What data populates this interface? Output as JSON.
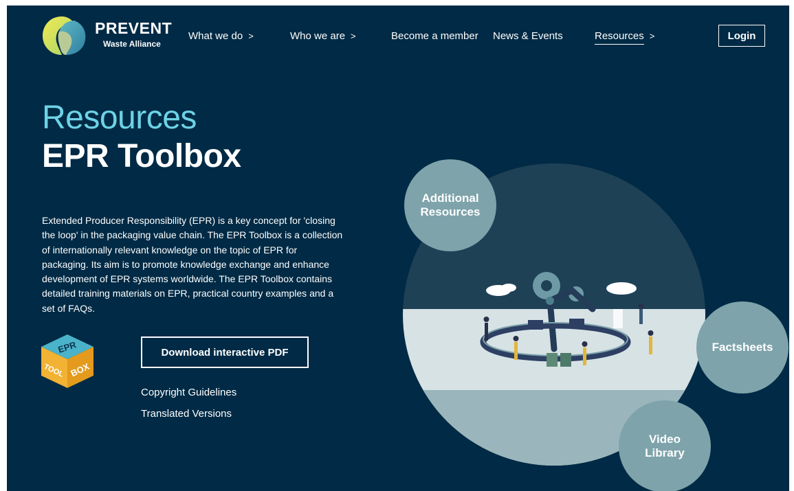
{
  "header": {
    "logo_word": "PREVENT",
    "logo_sub": "Waste Alliance",
    "nav": [
      {
        "label": "What we do",
        "chevron": ">"
      },
      {
        "label": "Who we are",
        "chevron": ">"
      },
      {
        "label": "Become a member"
      },
      {
        "label": "News & Events"
      },
      {
        "label": "Resources",
        "chevron": ">",
        "active": true
      }
    ],
    "login_label": "Login"
  },
  "hero": {
    "title": "Resources",
    "subtitle": "EPR Toolbox",
    "description": "Extended Producer Responsibility (EPR) is a key concept for 'closing the loop' in the packaging value chain. The EPR Toolbox is a collection of internationally relevant knowledge on the topic of EPR for packaging. Its aim is to promote knowledge exchange and enhance development of EPR systems worldwide. The EPR Toolbox contains detailed training materials on EPR, practical country examples and a set of FAQs.",
    "download_label": "Download interactive PDF",
    "links": [
      "Copyright Guidelines",
      "Translated Versions"
    ]
  },
  "epr_logo_text": [
    "EPR",
    "TOOL",
    "BOX"
  ],
  "bubbles": {
    "additional": "Additional Resources",
    "factsheets": "Factsheets",
    "video": "Video Library"
  },
  "colors": {
    "background": "#002a45",
    "accent": "#6dd3e6",
    "bubble": "#7ea3ab",
    "logo_yellow": "#e7e34b",
    "logo_teal": "#4ea0b4"
  }
}
